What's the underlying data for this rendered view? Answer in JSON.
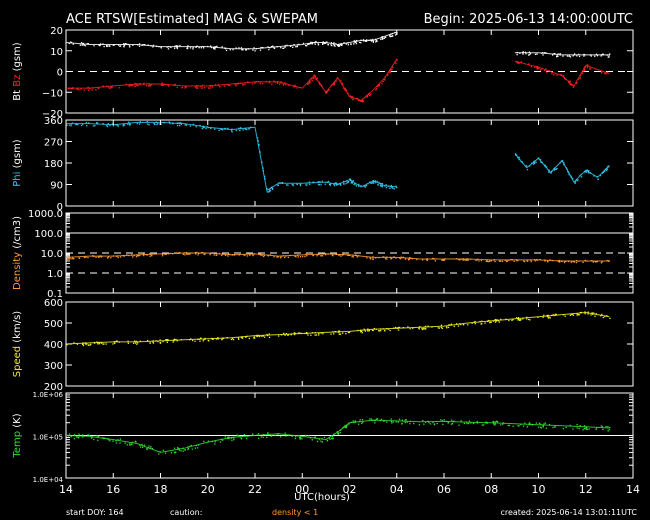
{
  "header": {
    "title": "ACE RTSW[Estimated] MAG & SWEPAM",
    "begin": "Begin: 2025-06-13 14:00:00UTC"
  },
  "footer": {
    "start_doy": "start DOY: 164",
    "caution_label": "caution:",
    "caution_text": "density < 1",
    "created": "created: 2025-06-14 13:01:11UTC"
  },
  "colors": {
    "bt": "#ffffff",
    "bz": "#ff2020",
    "phi": "#30c8f0",
    "density": "#ff9a30",
    "speed": "#f0f020",
    "temp": "#30e030",
    "axis": "#ffffff",
    "caution": "#ff9a30"
  },
  "chart_data": {
    "type": "scatter",
    "xlabel": "UTC(hours)",
    "xlim": [
      14,
      38
    ],
    "xticks": [
      14,
      16,
      18,
      20,
      22,
      24,
      26,
      28,
      30,
      32,
      34,
      36,
      38
    ],
    "xtick_labels": [
      "14",
      "16",
      "18",
      "20",
      "22",
      "00",
      "02",
      "04",
      "06",
      "08",
      "10",
      "12",
      "14"
    ],
    "panels": [
      {
        "id": "mag",
        "ylabel_parts": [
          {
            "text": "Bt ",
            "color": "#ffffff"
          },
          {
            "text": "Bz ",
            "color": "#ff2020"
          },
          {
            "text": "(gsm)",
            "color": "#ffffff"
          }
        ],
        "scale": "linear",
        "ylim": [
          -20,
          20
        ],
        "yticks": [
          -20,
          -10,
          0,
          10,
          20
        ],
        "ytick_labels": [
          "−20",
          "−10",
          "0",
          "10",
          "20"
        ],
        "ref_lines": [
          {
            "y": 0,
            "dashed": true
          }
        ],
        "series": [
          {
            "name": "Bt",
            "color": "#ffffff",
            "points": [
              [
                14,
                14
              ],
              [
                15,
                13
              ],
              [
                16,
                13
              ],
              [
                17,
                13
              ],
              [
                18,
                12
              ],
              [
                19,
                12
              ],
              [
                20,
                12
              ],
              [
                21,
                11
              ],
              [
                22,
                11
              ],
              [
                23,
                12
              ],
              [
                24,
                13
              ],
              [
                24.5,
                14
              ],
              [
                25,
                14
              ],
              [
                25.5,
                13
              ],
              [
                26,
                14
              ],
              [
                26.5,
                15
              ],
              [
                27,
                15
              ],
              [
                27.5,
                17
              ],
              [
                28,
                19
              ],
              [
                33,
                9
              ],
              [
                34,
                9
              ],
              [
                35,
                8
              ],
              [
                36,
                8
              ],
              [
                37,
                8
              ]
            ]
          },
          {
            "name": "Bz",
            "color": "#ff2020",
            "points": [
              [
                14,
                -8
              ],
              [
                15,
                -8
              ],
              [
                16,
                -7
              ],
              [
                17,
                -6
              ],
              [
                18,
                -6
              ],
              [
                19,
                -7
              ],
              [
                20,
                -7
              ],
              [
                21,
                -6
              ],
              [
                22,
                -5
              ],
              [
                23,
                -5
              ],
              [
                24,
                -8
              ],
              [
                24.5,
                -2
              ],
              [
                25,
                -10
              ],
              [
                25.5,
                -3
              ],
              [
                26,
                -12
              ],
              [
                26.5,
                -14
              ],
              [
                27,
                -9
              ],
              [
                27.5,
                -3
              ],
              [
                28,
                6
              ],
              [
                33,
                5
              ],
              [
                34,
                2
              ],
              [
                35,
                -2
              ],
              [
                35.5,
                -7
              ],
              [
                36,
                3
              ],
              [
                37,
                -1
              ]
            ]
          }
        ]
      },
      {
        "id": "phi",
        "ylabel_parts": [
          {
            "text": "Phi ",
            "color": "#30c8f0"
          },
          {
            "text": "(gsm)",
            "color": "#ffffff"
          }
        ],
        "scale": "linear",
        "ylim": [
          0,
          360
        ],
        "yticks": [
          0,
          90,
          180,
          270,
          360
        ],
        "ytick_labels": [
          "0",
          "90",
          "180",
          "270",
          "360"
        ],
        "ref_lines": [],
        "series": [
          {
            "name": "Phi",
            "color": "#30c8f0",
            "points": [
              [
                14,
                345
              ],
              [
                15,
                345
              ],
              [
                16,
                340
              ],
              [
                17,
                350
              ],
              [
                18,
                350
              ],
              [
                19,
                345
              ],
              [
                20,
                330
              ],
              [
                21,
                320
              ],
              [
                22,
                330
              ],
              [
                22.5,
                65
              ],
              [
                23,
                95
              ],
              [
                24,
                95
              ],
              [
                25,
                100
              ],
              [
                25.5,
                90
              ],
              [
                26,
                110
              ],
              [
                26.5,
                80
              ],
              [
                27,
                105
              ],
              [
                27.5,
                85
              ],
              [
                28,
                80
              ],
              [
                33,
                220
              ],
              [
                33.5,
                160
              ],
              [
                34,
                200
              ],
              [
                34.5,
                140
              ],
              [
                35,
                190
              ],
              [
                35.5,
                100
              ],
              [
                36,
                150
              ],
              [
                36.5,
                120
              ],
              [
                37,
                170
              ]
            ]
          }
        ]
      },
      {
        "id": "density",
        "ylabel_parts": [
          {
            "text": "Density ",
            "color": "#ff9a30"
          },
          {
            "text": "(/cm3)",
            "color": "#ffffff"
          }
        ],
        "scale": "log",
        "ylim": [
          0.1,
          1000
        ],
        "yticks": [
          0.1,
          1,
          10,
          100,
          1000
        ],
        "ytick_labels": [
          "0.1",
          "1.0",
          "10.0",
          "100.0",
          "1000.0"
        ],
        "ref_lines": [
          {
            "y": 1,
            "dashed": true
          },
          {
            "y": 10,
            "dashed": true
          },
          {
            "y": 100,
            "dashed": false
          }
        ],
        "series": [
          {
            "name": "Density",
            "color": "#ff9a30",
            "points": [
              [
                14,
                6
              ],
              [
                15,
                7
              ],
              [
                16,
                7
              ],
              [
                17,
                8
              ],
              [
                18,
                9
              ],
              [
                19,
                10
              ],
              [
                20,
                10
              ],
              [
                21,
                8
              ],
              [
                22,
                9
              ],
              [
                23,
                7
              ],
              [
                24,
                8
              ],
              [
                25,
                9
              ],
              [
                26,
                8
              ],
              [
                27,
                6
              ],
              [
                28,
                6
              ],
              [
                29,
                5
              ],
              [
                30,
                5
              ],
              [
                31,
                5
              ],
              [
                32,
                4.5
              ],
              [
                33,
                4.5
              ],
              [
                34,
                4.5
              ],
              [
                35,
                4
              ],
              [
                36,
                4
              ],
              [
                37,
                4
              ]
            ]
          }
        ]
      },
      {
        "id": "speed",
        "ylabel_parts": [
          {
            "text": "Speed ",
            "color": "#f0f020"
          },
          {
            "text": "(km/s)",
            "color": "#ffffff"
          }
        ],
        "scale": "linear",
        "ylim": [
          200,
          600
        ],
        "yticks": [
          200,
          300,
          400,
          500,
          600
        ],
        "ytick_labels": [
          "200",
          "300",
          "400",
          "500",
          "600"
        ],
        "ref_lines": [],
        "series": [
          {
            "name": "Speed",
            "color": "#f0f020",
            "points": [
              [
                14,
                400
              ],
              [
                15,
                405
              ],
              [
                16,
                410
              ],
              [
                17,
                410
              ],
              [
                18,
                415
              ],
              [
                19,
                420
              ],
              [
                20,
                425
              ],
              [
                21,
                430
              ],
              [
                22,
                440
              ],
              [
                23,
                445
              ],
              [
                24,
                450
              ],
              [
                25,
                455
              ],
              [
                26,
                460
              ],
              [
                27,
                470
              ],
              [
                28,
                475
              ],
              [
                29,
                480
              ],
              [
                30,
                485
              ],
              [
                31,
                500
              ],
              [
                32,
                510
              ],
              [
                33,
                520
              ],
              [
                34,
                530
              ],
              [
                35,
                540
              ],
              [
                36,
                550
              ],
              [
                37,
                530
              ]
            ]
          }
        ]
      },
      {
        "id": "temp",
        "ylabel_parts": [
          {
            "text": "Temp ",
            "color": "#30e030"
          },
          {
            "text": "(K)",
            "color": "#ffffff"
          }
        ],
        "scale": "log",
        "ylim": [
          10000,
          1000000
        ],
        "yticks": [
          10000,
          100000,
          1000000
        ],
        "ytick_labels": [
          "1.0E+04",
          "1.0E+05",
          "1.0E+06"
        ],
        "ref_lines": [
          {
            "y": 100000,
            "dashed": false
          }
        ],
        "series": [
          {
            "name": "Temp",
            "color": "#30e030",
            "points": [
              [
                14,
                100000
              ],
              [
                15,
                95000
              ],
              [
                16,
                80000
              ],
              [
                17,
                65000
              ],
              [
                18,
                40000
              ],
              [
                19,
                50000
              ],
              [
                20,
                70000
              ],
              [
                21,
                90000
              ],
              [
                22,
                100000
              ],
              [
                23,
                110000
              ],
              [
                24,
                95000
              ],
              [
                25,
                80000
              ],
              [
                25.5,
                120000
              ],
              [
                26,
                200000
              ],
              [
                27,
                230000
              ],
              [
                28,
                220000
              ],
              [
                29,
                210000
              ],
              [
                30,
                215000
              ],
              [
                31,
                205000
              ],
              [
                32,
                200000
              ],
              [
                33,
                190000
              ],
              [
                34,
                180000
              ],
              [
                35,
                170000
              ],
              [
                36,
                160000
              ],
              [
                37,
                150000
              ]
            ]
          }
        ]
      }
    ]
  }
}
